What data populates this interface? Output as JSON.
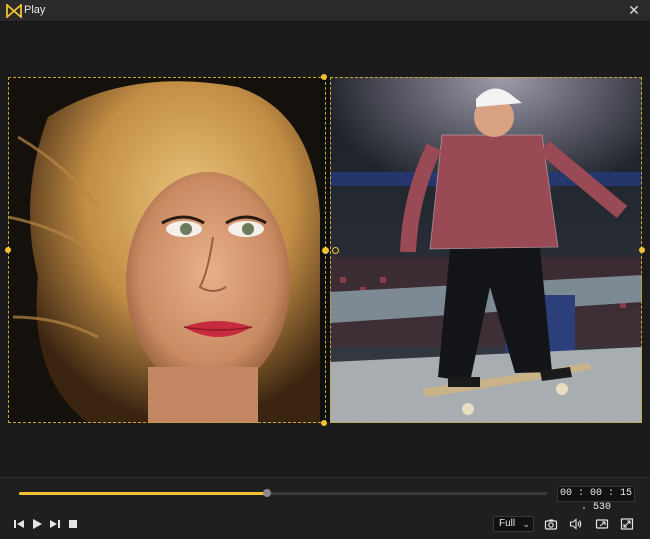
{
  "window": {
    "title": "Play",
    "close_glyph": "✕",
    "logo_icon": "play-logo-icon",
    "accent_color": "#f2c232"
  },
  "preview": {
    "left_clip": {
      "subject": "portrait-woman-blonde"
    },
    "right_clip": {
      "subject": "skateboarder-arena"
    }
  },
  "playback": {
    "progress": 0.47,
    "time": "00 : 00 : 15 . 530"
  },
  "toolbar": {
    "prev_frame_icon": "previous-frame-icon",
    "play_icon": "play-icon",
    "next_frame_icon": "next-frame-icon",
    "stop_icon": "stop-icon",
    "zoom_select": {
      "value": "Full"
    },
    "snapshot_icon": "camera-icon",
    "volume_icon": "volume-icon",
    "pip_icon": "picture-in-picture-icon",
    "fullscreen_icon": "fullscreen-icon"
  }
}
